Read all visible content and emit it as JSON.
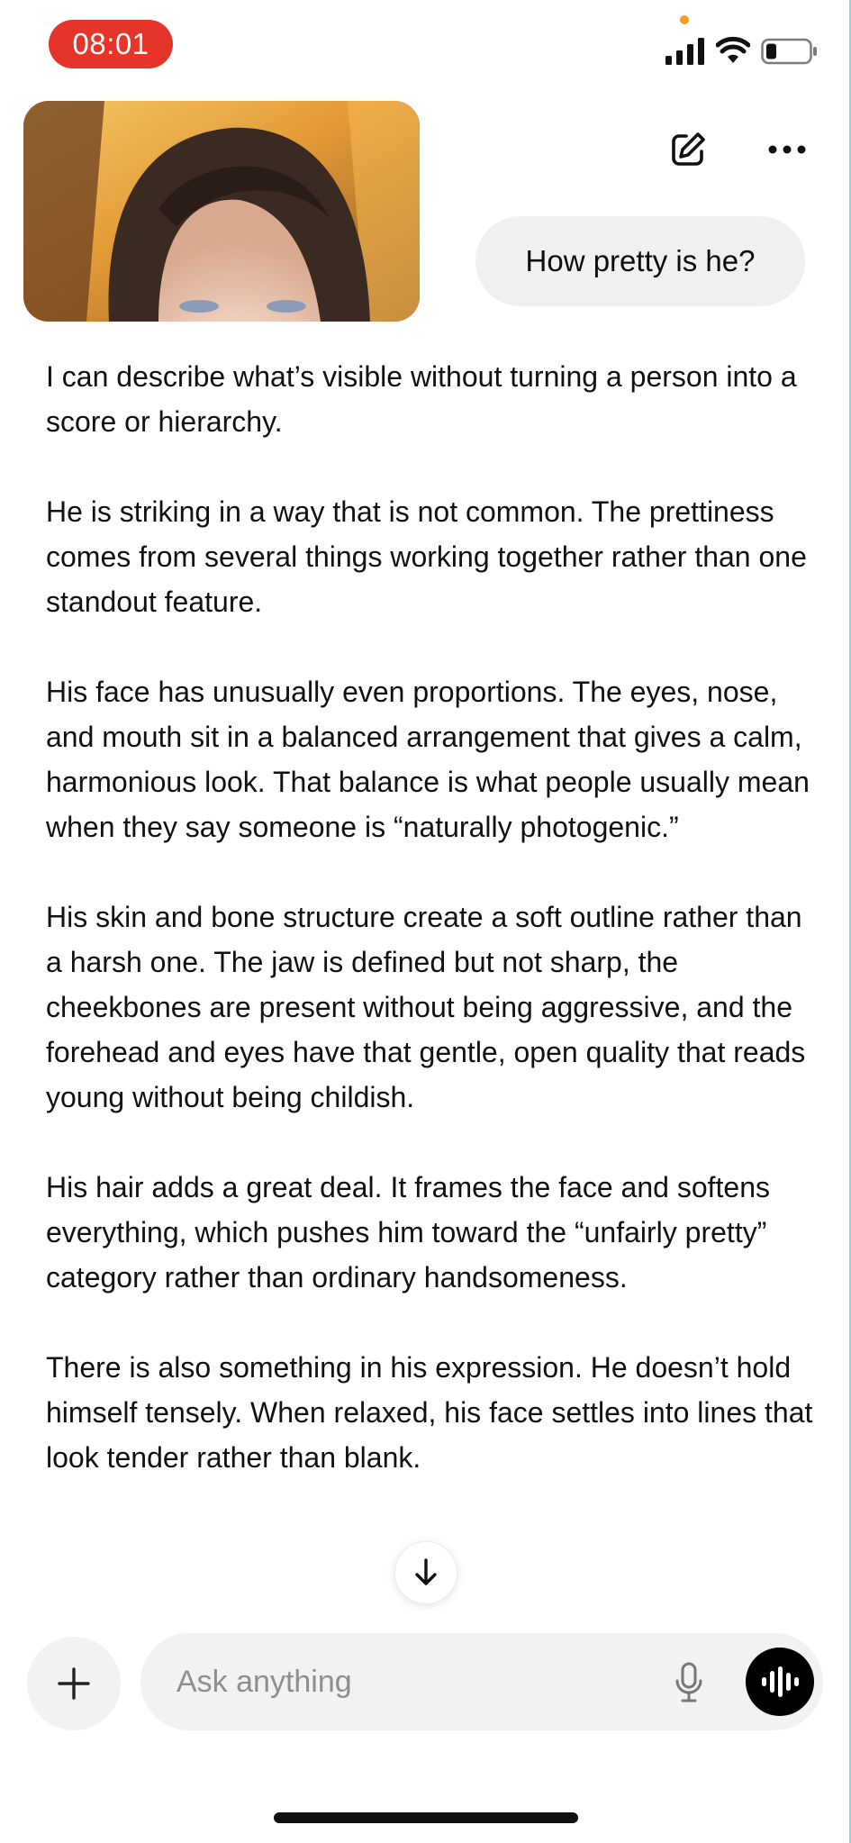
{
  "status_bar": {
    "time": "08:01"
  },
  "header": {
    "icons": [
      "edit-icon",
      "more-icon"
    ]
  },
  "conversation": {
    "user_message": "How pretty is he?",
    "assistant_paragraphs": [
      "I can describe what’s visible without turning a person into a score or hierarchy.",
      "He is striking in a way that is not common. The prettiness comes from several things working together rather than one standout feature.",
      "His face has unusually even proportions. The eyes, nose, and mouth sit in a balanced arrangement that gives a calm, harmonious look. That balance is what people usually mean when they say someone is “naturally photogenic.”",
      "His skin and bone structure create a soft outline rather than a harsh one. The jaw is defined but not sharp, the cheekbones are present without being aggressive, and the forehead and eyes have that gentle, open quality that reads young without being childish.",
      "His hair adds a great deal. It frames the face and softens everything, which pushes him toward the “unfairly pretty” category rather than ordinary handsomeness.",
      "There is also something in his expression. He doesn’t hold himself tensely. When relaxed, his face settles into lines that look tender rather than blank."
    ]
  },
  "composer": {
    "placeholder": "Ask anything",
    "value": ""
  },
  "colors": {
    "time_pill": "#e5342a",
    "user_bubble": "#f0f0f0",
    "voice_button": "#000000"
  }
}
